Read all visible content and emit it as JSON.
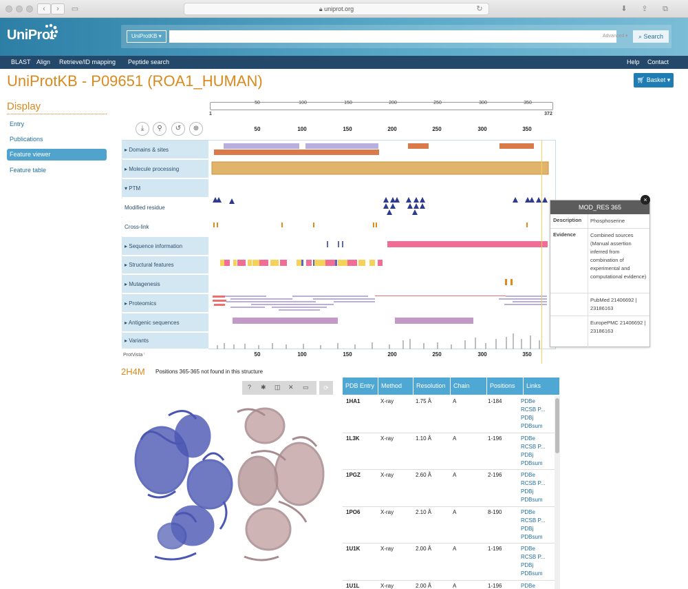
{
  "browser": {
    "url": "uniprot.org"
  },
  "header": {
    "logo": "UniProt",
    "db_select": "UniProtKB ▾",
    "advanced": "Advanced ▾",
    "search": "Search"
  },
  "subnav": {
    "blast": "BLAST",
    "align": "Align",
    "retrieve": "Retrieve/ID mapping",
    "peptide": "Peptide search",
    "help": "Help",
    "contact": "Contact"
  },
  "page": {
    "title_prefix": "UniProtKB - ",
    "accession": "P09651 (ROA1_HUMAN)",
    "basket": "Basket ▾"
  },
  "sidebar": {
    "heading": "Display",
    "items": [
      {
        "label": "Entry"
      },
      {
        "label": "Publications"
      },
      {
        "label": "Feature viewer"
      },
      {
        "label": "Feature table"
      }
    ]
  },
  "ruler": {
    "start": "1",
    "end": "372",
    "ticks": [
      "50",
      "100",
      "150",
      "200",
      "250",
      "300",
      "350"
    ]
  },
  "tracks": [
    {
      "label": "▸ Domains & sites"
    },
    {
      "label": "▸ Molecule processing"
    },
    {
      "label": "▾ PTM"
    },
    {
      "label": "Modified residue"
    },
    {
      "label": "Cross-link"
    },
    {
      "label": "▸ Sequence information"
    },
    {
      "label": "▸ Structural features"
    },
    {
      "label": "▸ Mutagenesis"
    },
    {
      "label": "▸ Proteomics"
    },
    {
      "label": "▸ Antigenic sequences"
    },
    {
      "label": "▸ Variants"
    }
  ],
  "protvista": "ProtVista ⁱ",
  "popup": {
    "title": "MOD_RES 365",
    "description_label": "Description",
    "description": "Phosphoserine",
    "evidence_label": "Evidence",
    "evidence": "Combined sources (Manual assertion inferred from combination of experimental and computational evidence)",
    "pubmed": "PubMed 21406692 | 23186163",
    "europepmc": "EuropePMC 21406692 | 23186163"
  },
  "structure": {
    "pdb_id": "2H4M",
    "message": "Positions 365-365 not found in this structure"
  },
  "pdb_table": {
    "headers": [
      "PDB Entry",
      "Method",
      "Resolution",
      "Chain",
      "Positions",
      "Links"
    ],
    "rows": [
      {
        "entry": "1HA1",
        "method": "X-ray",
        "res": "1.75 Å",
        "chain": "A",
        "pos": "1-184"
      },
      {
        "entry": "1L3K",
        "method": "X-ray",
        "res": "1.10 Å",
        "chain": "A",
        "pos": "1-196"
      },
      {
        "entry": "1PGZ",
        "method": "X-ray",
        "res": "2.60 Å",
        "chain": "A",
        "pos": "2-196"
      },
      {
        "entry": "1PO6",
        "method": "X-ray",
        "res": "2.10 Å",
        "chain": "A",
        "pos": "8-190"
      },
      {
        "entry": "1U1K",
        "method": "X-ray",
        "res": "2.00 Å",
        "chain": "A",
        "pos": "1-196"
      },
      {
        "entry": "1U1L",
        "method": "X-ray",
        "res": "2.00 Å",
        "chain": "A",
        "pos": "1-196"
      }
    ],
    "links": [
      "PDBe",
      "RCSB P...",
      "PDBj",
      "PDBsum"
    ]
  },
  "colors": {
    "brand": "#2d7fa6",
    "title": "#d98a1f",
    "domain": "#b8aee0",
    "region": "#d97a4a",
    "chain": "#e0b46a",
    "ptm": "#2e3a8c",
    "helix": "#f06e96",
    "strand": "#f5d35a"
  }
}
